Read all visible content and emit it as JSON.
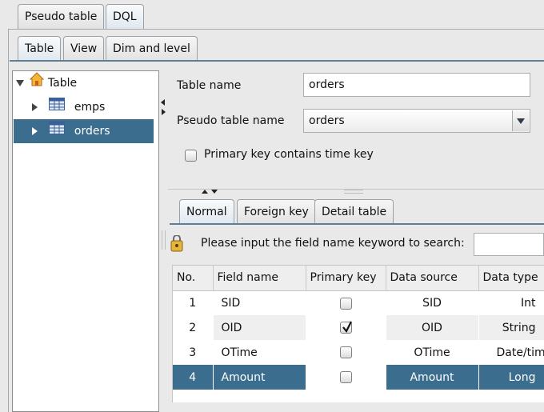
{
  "top_tabs": [
    "Pseudo table",
    "DQL"
  ],
  "sub_tabs": [
    "Table",
    "View",
    "Dim and level"
  ],
  "tree": {
    "root_label": "Table",
    "items": [
      {
        "label": "emps"
      },
      {
        "label": "orders"
      }
    ]
  },
  "form": {
    "table_name_label": "Table name",
    "table_name_value": "orders",
    "pseudo_table_name_label": "Pseudo table name",
    "pseudo_table_name_value": "orders",
    "primary_key_time_label": "Primary key contains time key"
  },
  "detail_tabs": [
    "Normal",
    "Foreign key",
    "Detail table"
  ],
  "search": {
    "label": "Please input the field name keyword to search:",
    "value": ""
  },
  "table": {
    "columns": [
      "No.",
      "Field name",
      "Primary key",
      "Data source",
      "Data type"
    ],
    "rows": [
      {
        "no": "1",
        "field_name": "SID",
        "primary_key": false,
        "data_source": "SID",
        "data_type": "Int"
      },
      {
        "no": "2",
        "field_name": "OID",
        "primary_key": true,
        "data_source": "OID",
        "data_type": "String"
      },
      {
        "no": "3",
        "field_name": "OTime",
        "primary_key": false,
        "data_source": "OTime",
        "data_type": "Date/time"
      },
      {
        "no": "4",
        "field_name": "Amount",
        "primary_key": false,
        "data_source": "Amount",
        "data_type": "Long"
      }
    ]
  },
  "colors": {
    "selection": "#3a6d8e",
    "panel_bg": "#e9e9e9",
    "alt_row": "#efefef"
  }
}
